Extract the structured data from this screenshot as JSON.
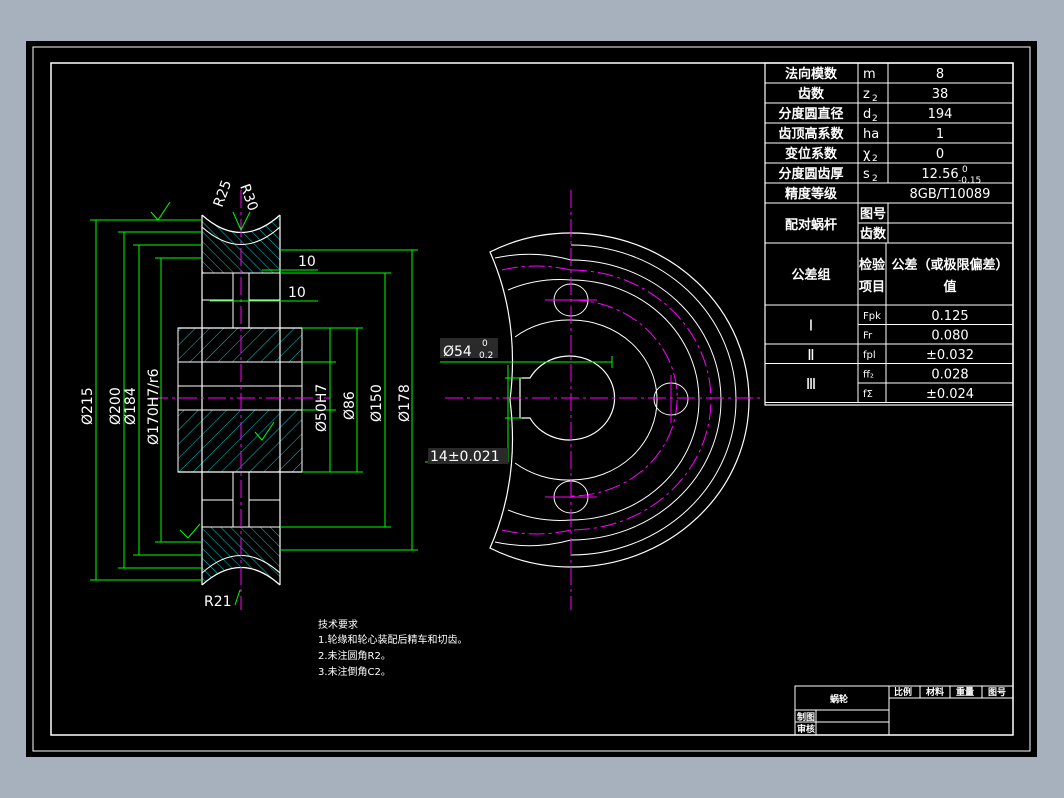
{
  "colors": {
    "background": "#a7b1bd",
    "sheet": "#000000",
    "outline": "#ffffff",
    "dimension": "#00ff00",
    "centerline": "#ff00ff",
    "hatch": "#00c8c8",
    "break_line": "#00c8c8"
  },
  "params": [
    {
      "name": "法向模数",
      "sym": "m",
      "sub": "",
      "val": "8",
      "val_sub": "",
      "val_sup": ""
    },
    {
      "name": "齿数",
      "sym": "z",
      "sub": "2",
      "val": "38",
      "val_sub": "",
      "val_sup": ""
    },
    {
      "name": "分度圆直径",
      "sym": "d",
      "sub": "2",
      "val": "194",
      "val_sub": "",
      "val_sup": ""
    },
    {
      "name": "齿顶高系数",
      "sym": "ha",
      "sub": "",
      "val": "1",
      "val_sub": "",
      "val_sup": ""
    },
    {
      "name": "变位系数",
      "sym": "χ",
      "sub": "2",
      "val": "0",
      "val_sub": "",
      "val_sup": ""
    },
    {
      "name": "分度圆齿厚",
      "sym": "s",
      "sub": "2",
      "val": "12.56",
      "val_sub": "-0.15",
      "val_sup": "0"
    },
    {
      "name": "精度等级",
      "sym": "",
      "sub": "",
      "val": "8GB/T10089",
      "val_sub": "",
      "val_sup": ""
    }
  ],
  "mate": {
    "label": "配对蜗杆",
    "r1": "图号",
    "r2": "齿数"
  },
  "tol_header": {
    "group": "公差组",
    "item_a": "检验",
    "item_b": "项目",
    "val_a": "公差（或极限偏差）",
    "val_b": "值"
  },
  "tol_rows": [
    {
      "group": "Ⅰ",
      "items": [
        {
          "sym": "Fpk",
          "val": "0.125"
        },
        {
          "sym": "Fr",
          "val": "0.080"
        }
      ]
    },
    {
      "group": "Ⅱ",
      "items": [
        {
          "sym": "fpl",
          "val": "±0.032"
        }
      ]
    },
    {
      "group": "Ⅲ",
      "items": [
        {
          "sym": "ff₂",
          "val": "0.028"
        },
        {
          "sym": "fΣ",
          "val": "±0.024"
        }
      ]
    }
  ],
  "dims": {
    "r25": "R25",
    "r30": "R30",
    "r21": "R21",
    "w10a": "10",
    "w10b": "10",
    "d215": "Ø215",
    "d200": "Ø200",
    "d184": "Ø184",
    "d170": "Ø170H7/r6",
    "d50": "Ø50H7",
    "d86": "Ø86",
    "d150": "Ø150",
    "d178": "Ø178",
    "d54": "Ø54",
    "d54_sup": "0",
    "d54_sub": "0.2",
    "key": "14±0.021"
  },
  "notes": {
    "title": "技术要求",
    "lines": [
      "1.轮缘和轮心装配后精车和切齿。",
      "2.未注圆角R2。",
      "3.未注倒角C2。"
    ]
  },
  "title_block": {
    "name": "蜗轮",
    "col1": "比例",
    "col2": "材料",
    "col3": "重量",
    "col4": "图号",
    "row1": "制图",
    "row2": "审核"
  }
}
